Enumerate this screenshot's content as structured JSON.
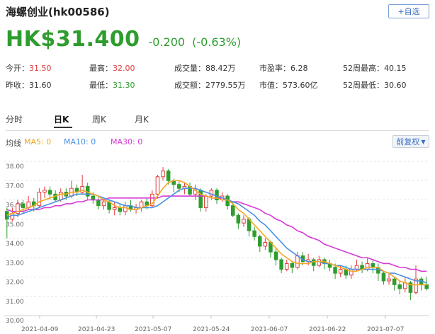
{
  "header": {
    "title": "海螺创业(hk00586)",
    "add_button": "+自选"
  },
  "quote": {
    "price": "HK$31.400",
    "change": "-0.200",
    "change_pct": "(-0.63%)"
  },
  "stats": {
    "open_label": "今开：",
    "open_value": "31.50",
    "prev_close_label": "昨收：",
    "prev_close_value": "31.60",
    "high_label": "最高：",
    "high_value": "32.00",
    "low_label": "最低：",
    "low_value": "31.30",
    "volume_label": "成交量：",
    "volume_value": "88.42万",
    "turnover_label": "成交额：",
    "turnover_value": "2779.55万",
    "pe_label": "市盈率：",
    "pe_value": "6.28",
    "mcap_label": "市值：",
    "mcap_value": "573.60亿",
    "w52_high_label": "52周最高：",
    "w52_high_value": "40.15",
    "w52_low_label": "52周最低：",
    "w52_low_value": "30.60"
  },
  "tabs": [
    "分时",
    "日K",
    "周K",
    "月K"
  ],
  "active_tab": "日K",
  "ma_legend": {
    "label": "均线",
    "ma5": "MA5: 0",
    "ma10": "MA10: 0",
    "ma30": "MA30: 0",
    "adjust_button": "前复权"
  },
  "colors": {
    "up": "#e23b3b",
    "down": "#2e9d2e",
    "ma5": "#f5a623",
    "ma10": "#4a90e2",
    "ma30": "#d63ad6",
    "grid": "#e3e3e3"
  },
  "chart_data": {
    "type": "candlestick",
    "ylim": [
      30.0,
      38.0
    ],
    "y_ticks": [
      "38.00",
      "37.00",
      "36.00",
      "35.00",
      "34.00",
      "33.00",
      "32.00",
      "31.00",
      "30.00"
    ],
    "x_ticks": [
      "2021-04-09",
      "2021-04-23",
      "2021-05-07",
      "2021-05-24",
      "2021-06-07",
      "2021-06-22",
      "2021-07-07"
    ],
    "candles": [
      [
        35.4,
        35.0,
        35.6,
        34.0
      ],
      [
        35.0,
        35.3,
        35.6,
        34.9
      ],
      [
        35.3,
        35.8,
        36.0,
        35.1
      ],
      [
        35.8,
        35.6,
        36.0,
        35.3
      ],
      [
        35.6,
        35.9,
        36.2,
        35.5
      ],
      [
        35.9,
        35.7,
        36.1,
        35.4
      ],
      [
        35.7,
        36.4,
        36.6,
        35.6
      ],
      [
        36.4,
        36.5,
        36.7,
        36.1
      ],
      [
        36.5,
        36.3,
        36.7,
        36.0
      ],
      [
        36.3,
        36.0,
        36.5,
        35.9
      ],
      [
        36.0,
        36.4,
        36.6,
        35.9
      ],
      [
        36.4,
        36.2,
        36.6,
        36.0
      ],
      [
        36.2,
        36.6,
        37.0,
        36.1
      ],
      [
        36.6,
        36.4,
        36.8,
        36.2
      ],
      [
        36.4,
        36.7,
        37.3,
        36.3
      ],
      [
        36.7,
        36.2,
        36.9,
        36.0
      ],
      [
        36.2,
        36.0,
        36.4,
        35.8
      ],
      [
        36.0,
        35.7,
        36.2,
        35.5
      ],
      [
        35.7,
        35.9,
        36.1,
        35.5
      ],
      [
        35.9,
        35.5,
        36.0,
        35.3
      ],
      [
        35.5,
        35.6,
        35.9,
        35.2
      ],
      [
        35.6,
        35.4,
        35.8,
        35.2
      ],
      [
        35.4,
        35.7,
        35.9,
        35.2
      ],
      [
        35.7,
        35.5,
        36.0,
        35.4
      ],
      [
        35.5,
        35.6,
        35.8,
        35.3
      ],
      [
        35.6,
        35.9,
        36.0,
        35.4
      ],
      [
        35.9,
        35.7,
        36.1,
        35.5
      ],
      [
        35.7,
        36.3,
        36.5,
        35.6
      ],
      [
        36.3,
        37.2,
        37.3,
        36.1
      ],
      [
        37.2,
        37.5,
        37.7,
        37.0
      ],
      [
        37.5,
        37.0,
        37.6,
        36.8
      ],
      [
        37.0,
        36.8,
        37.1,
        36.4
      ],
      [
        36.8,
        36.6,
        37.0,
        36.4
      ],
      [
        36.6,
        36.7,
        36.9,
        36.3
      ],
      [
        36.7,
        36.3,
        36.9,
        36.2
      ],
      [
        36.3,
        36.5,
        36.8,
        36.0
      ],
      [
        36.5,
        35.6,
        36.6,
        35.4
      ],
      [
        35.6,
        36.2,
        36.3,
        35.4
      ],
      [
        36.2,
        36.5,
        36.6,
        36.0
      ],
      [
        36.5,
        36.0,
        36.6,
        35.8
      ],
      [
        36.0,
        36.2,
        36.4,
        35.9
      ],
      [
        36.2,
        35.7,
        36.3,
        35.5
      ],
      [
        35.7,
        35.2,
        35.9,
        35.1
      ],
      [
        35.2,
        34.8,
        35.3,
        34.5
      ],
      [
        34.8,
        35.0,
        35.2,
        34.6
      ],
      [
        35.0,
        34.4,
        35.1,
        34.1
      ],
      [
        34.4,
        34.1,
        34.6,
        33.9
      ],
      [
        34.1,
        33.6,
        34.2,
        33.3
      ],
      [
        33.6,
        33.8,
        34.0,
        33.4
      ],
      [
        33.8,
        33.3,
        33.9,
        33.0
      ],
      [
        33.3,
        32.9,
        33.5,
        32.6
      ],
      [
        32.9,
        32.4,
        33.0,
        32.2
      ],
      [
        32.4,
        32.7,
        32.9,
        32.3
      ],
      [
        32.7,
        32.5,
        32.8,
        32.2
      ],
      [
        32.5,
        33.1,
        33.3,
        32.4
      ],
      [
        33.1,
        32.8,
        33.3,
        32.6
      ],
      [
        32.8,
        32.9,
        33.2,
        32.6
      ],
      [
        32.9,
        32.6,
        33.0,
        32.3
      ],
      [
        32.6,
        32.9,
        33.1,
        32.5
      ],
      [
        32.9,
        32.7,
        33.0,
        32.4
      ],
      [
        32.7,
        32.5,
        32.9,
        32.3
      ],
      [
        32.5,
        32.2,
        32.7,
        31.9
      ],
      [
        32.2,
        32.4,
        32.6,
        32.0
      ],
      [
        32.4,
        32.1,
        32.6,
        31.9
      ],
      [
        32.1,
        32.4,
        32.6,
        31.9
      ],
      [
        32.4,
        32.6,
        32.9,
        32.3
      ],
      [
        32.6,
        32.4,
        32.8,
        32.2
      ],
      [
        32.4,
        32.7,
        33.0,
        32.3
      ],
      [
        32.7,
        32.5,
        32.9,
        32.2
      ],
      [
        32.5,
        32.2,
        32.7,
        31.8
      ],
      [
        32.2,
        31.8,
        32.3,
        31.6
      ],
      [
        31.8,
        31.9,
        32.2,
        31.6
      ],
      [
        31.9,
        31.6,
        32.0,
        31.3
      ],
      [
        31.6,
        31.4,
        31.8,
        31.1
      ],
      [
        31.4,
        31.7,
        32.0,
        31.2
      ],
      [
        31.7,
        31.2,
        31.8,
        30.8
      ],
      [
        31.2,
        31.9,
        32.6,
        31.1
      ],
      [
        31.9,
        31.6,
        32.0,
        31.3
      ],
      [
        31.6,
        31.4,
        32.0,
        31.3
      ]
    ],
    "ma5": [
      35.2,
      35.3,
      35.4,
      35.5,
      35.6,
      35.7,
      35.9,
      36.0,
      36.1,
      36.2,
      36.3,
      36.3,
      36.4,
      36.4,
      36.5,
      36.4,
      36.3,
      36.2,
      36.0,
      35.9,
      35.7,
      35.6,
      35.6,
      35.5,
      35.5,
      35.6,
      35.7,
      35.8,
      36.2,
      36.6,
      36.9,
      37.0,
      37.0,
      36.9,
      36.7,
      36.5,
      36.3,
      36.2,
      36.1,
      36.1,
      36.0,
      36.0,
      35.8,
      35.5,
      35.3,
      35.0,
      34.7,
      34.4,
      34.1,
      33.8,
      33.5,
      33.2,
      33.0,
      32.8,
      32.7,
      32.7,
      32.7,
      32.8,
      32.8,
      32.8,
      32.7,
      32.6,
      32.5,
      32.4,
      32.3,
      32.3,
      32.4,
      32.5,
      32.5,
      32.5,
      32.3,
      32.2,
      32.0,
      31.8,
      31.7,
      31.6,
      31.6,
      31.6,
      31.6
    ],
    "ma10": [
      35.1,
      35.2,
      35.2,
      35.3,
      35.4,
      35.5,
      35.6,
      35.7,
      35.8,
      35.9,
      36.0,
      36.1,
      36.2,
      36.3,
      36.3,
      36.3,
      36.3,
      36.2,
      36.1,
      36.0,
      35.9,
      35.8,
      35.7,
      35.7,
      35.6,
      35.6,
      35.6,
      35.6,
      35.7,
      35.9,
      36.1,
      36.3,
      36.5,
      36.6,
      36.6,
      36.6,
      36.5,
      36.4,
      36.3,
      36.2,
      36.1,
      36.0,
      35.9,
      35.8,
      35.6,
      35.4,
      35.2,
      34.9,
      34.7,
      34.4,
      34.1,
      33.8,
      33.5,
      33.3,
      33.1,
      32.9,
      32.8,
      32.8,
      32.8,
      32.7,
      32.7,
      32.6,
      32.6,
      32.5,
      32.4,
      32.4,
      32.4,
      32.4,
      32.4,
      32.4,
      32.3,
      32.2,
      32.2,
      32.1,
      32.0,
      31.9,
      31.8,
      31.8,
      31.7
    ],
    "ma30": [
      35.5,
      35.4,
      35.4,
      35.4,
      35.5,
      35.5,
      35.5,
      35.6,
      35.6,
      35.7,
      35.7,
      35.8,
      35.8,
      35.9,
      35.9,
      36.0,
      36.0,
      36.0,
      36.0,
      36.1,
      36.1,
      36.1,
      36.1,
      36.1,
      36.1,
      36.1,
      36.1,
      36.1,
      36.1,
      36.2,
      36.2,
      36.2,
      36.2,
      36.2,
      36.2,
      36.2,
      36.2,
      36.2,
      36.1,
      36.1,
      36.1,
      36.0,
      35.9,
      35.9,
      35.8,
      35.7,
      35.6,
      35.5,
      35.3,
      35.2,
      35.0,
      34.9,
      34.7,
      34.6,
      34.4,
      34.3,
      34.1,
      34.0,
      33.9,
      33.7,
      33.6,
      33.5,
      33.4,
      33.3,
      33.2,
      33.1,
      33.0,
      33.0,
      32.9,
      32.8,
      32.7,
      32.7,
      32.6,
      32.5,
      32.5,
      32.4,
      32.4,
      32.3,
      32.3
    ]
  }
}
